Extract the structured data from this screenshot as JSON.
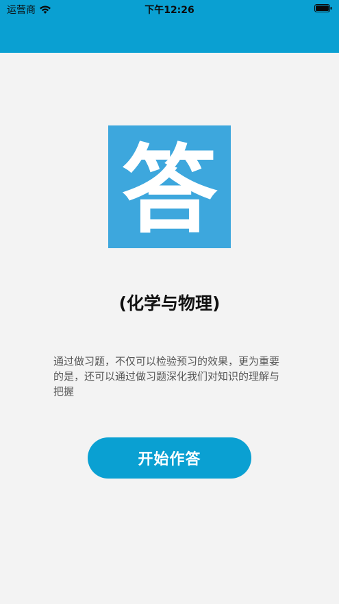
{
  "status_bar": {
    "carrier": "运营商",
    "time": "下午12:26",
    "wifi_icon": "wifi-icon",
    "battery_icon": "battery-icon"
  },
  "logo": {
    "glyph": "答",
    "background_color": "#3da7dd"
  },
  "title": "(化学与物理)",
  "description": "通过做习题，不仅可以检验预习的效果，更为重要的是，还可以通过做习题深化我们对知识的理解与把握",
  "start_button": {
    "label": "开始作答",
    "color": "#0aa0d2"
  },
  "colors": {
    "header": "#0aa0d2",
    "background": "#f3f3f3"
  }
}
